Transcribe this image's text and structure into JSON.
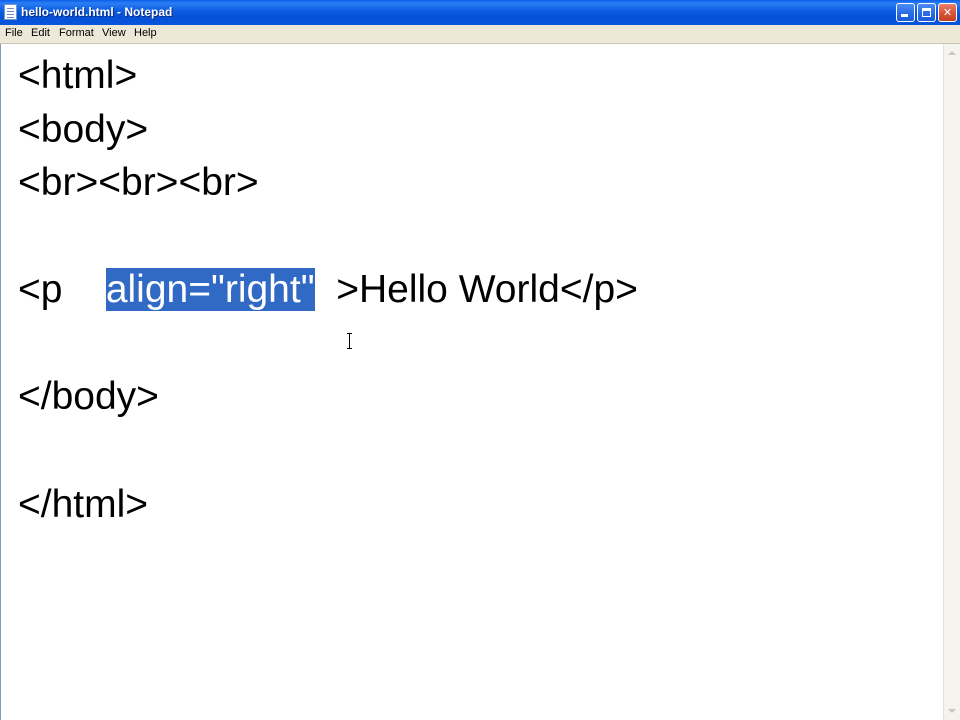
{
  "window": {
    "title": "hello-world.html - Notepad",
    "controls": {
      "minimize_icon": "minimize-icon",
      "maximize_icon": "maximize-icon",
      "close_label": "✕"
    }
  },
  "menu": {
    "items": [
      "File",
      "Edit",
      "Format",
      "View",
      "Help"
    ]
  },
  "editor": {
    "lines": [
      "<html>",
      "<body>",
      "<br><br><br>",
      "",
      "<p    ",
      "",
      "</body>",
      "",
      "</html>"
    ],
    "selected_line": {
      "before": "<p    ",
      "selection": "align=\"right\"",
      "after": "  >Hello World</p>"
    }
  },
  "colors": {
    "titlebar": "#0a55dc",
    "menubar": "#ece9d8",
    "selection": "#316ac5",
    "close_button": "#d9573a"
  }
}
